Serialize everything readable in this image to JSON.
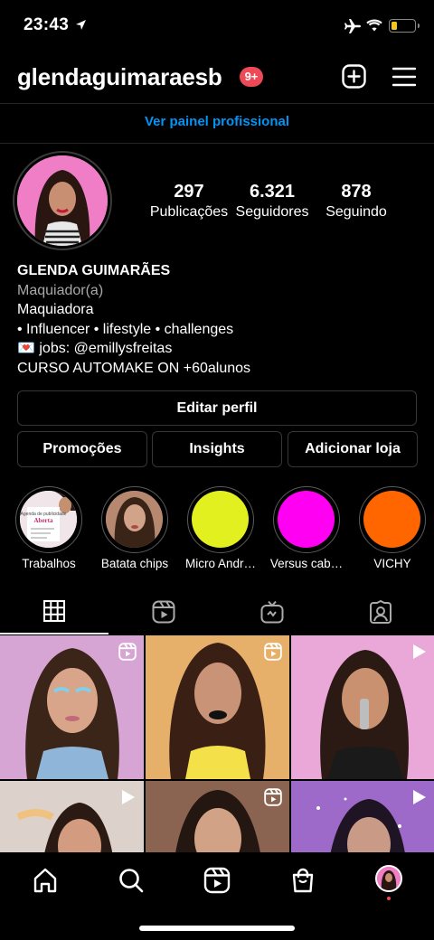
{
  "status_bar": {
    "time": "23:43"
  },
  "header": {
    "username": "glendaguimaraesb",
    "notifications_badge": "9+"
  },
  "pro_dashboard_link": "Ver painel profissional",
  "stats": [
    {
      "value": "297",
      "label": "Publicações"
    },
    {
      "value": "6.321",
      "label": "Seguidores"
    },
    {
      "value": "878",
      "label": "Seguindo"
    }
  ],
  "bio": {
    "name": "GLENDA GUIMARÃES",
    "category": "Maquiador(a)",
    "lines": [
      "Maquiadora",
      "• Influencer • lifestyle • challenges",
      "💌 jobs: @emillysfreitas",
      "CURSO AUTOMAKE ON +60alunos"
    ]
  },
  "buttons": {
    "edit_profile": "Editar perfil",
    "promotions": "Promoções",
    "insights": "Insights",
    "add_shop": "Adicionar loja"
  },
  "highlights": [
    {
      "label": "Trabalhos",
      "color": "#d9b7c9",
      "thumb_text": "Agenda de publicidade Aberta"
    },
    {
      "label": "Batata chips",
      "color": "#a06c58"
    },
    {
      "label": "Micro Andr…",
      "color": "#e2f01f"
    },
    {
      "label": "Versus cab…",
      "color": "#ff00f2"
    },
    {
      "label": "VICHY",
      "color": "#ff6600"
    }
  ],
  "tabs": [
    {
      "name": "grid",
      "active": true
    },
    {
      "name": "reels",
      "active": false
    },
    {
      "name": "igtv",
      "active": false
    },
    {
      "name": "tagged",
      "active": false
    }
  ],
  "grid_posts": [
    {
      "kind": "reel",
      "bg": "#d7a5d3"
    },
    {
      "kind": "reel",
      "bg": "#e7b06a"
    },
    {
      "kind": "video",
      "bg": "#e9a8d8"
    },
    {
      "kind": "video",
      "bg": "#ddd2cb"
    },
    {
      "kind": "reel",
      "bg": "#8a6450"
    },
    {
      "kind": "video",
      "bg": "#9d6ac9"
    }
  ],
  "colors": {
    "accent_blue": "#0095f6",
    "badge_red": "#ed4956",
    "border": "#363636"
  }
}
